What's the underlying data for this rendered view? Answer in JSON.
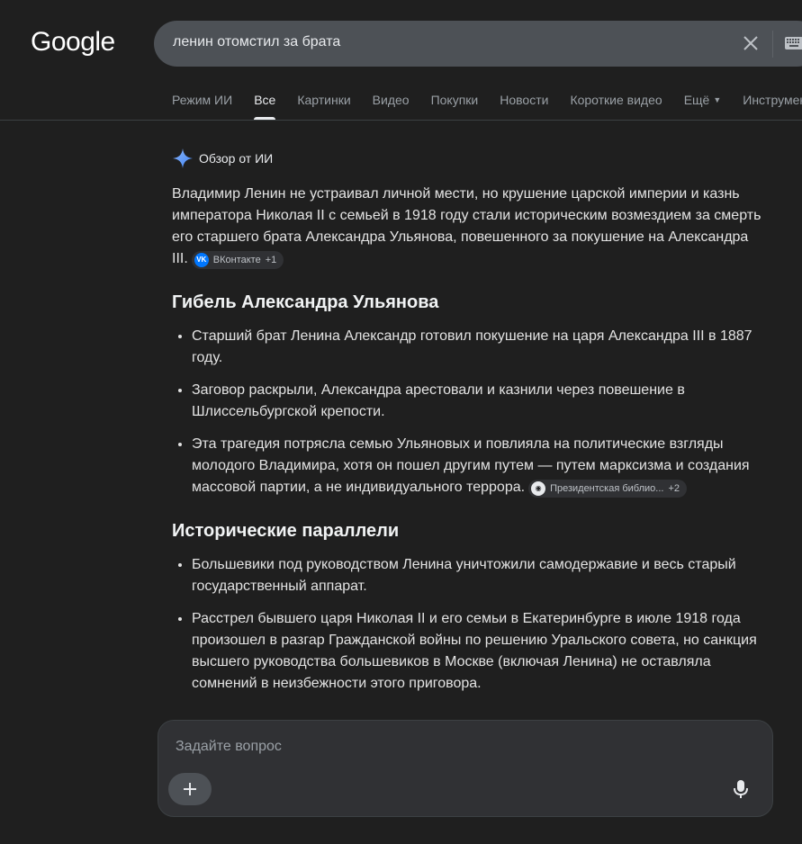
{
  "header": {
    "logo": "Google",
    "search_query": "ленин отомстил за брата"
  },
  "tabs": [
    {
      "label": "Режим ИИ"
    },
    {
      "label": "Все"
    },
    {
      "label": "Картинки"
    },
    {
      "label": "Видео"
    },
    {
      "label": "Покупки"
    },
    {
      "label": "Новости"
    },
    {
      "label": "Короткие видео"
    },
    {
      "label": "Ещё"
    },
    {
      "label": "Инструменты"
    }
  ],
  "ai_overview": {
    "label": "Обзор от ИИ",
    "intro": "Владимир Ленин не устраивал личной мести, но крушение царской империи и казнь императора Николая II с семьей в 1918 году стали историческим возмездием за смерть его старшего брата Александра Ульянова, повешенного за покушение на Александра III.",
    "intro_chip": {
      "source": "ВКонтакте",
      "count": "+1"
    },
    "sections": [
      {
        "heading": "Гибель Александра Ульянова",
        "bullets": [
          "Старший брат Ленина Александр готовил покушение на царя Александра III в 1887 году.",
          "Заговор раскрыли, Александра арестовали и казнили через повешение в Шлиссельбургской крепости.",
          "Эта трагедия потрясла семью Ульяновых и повлияла на политические взгляды молодого Владимира, хотя он пошел другим путем — путем марксизма и создания массовой партии, а не индивидуального террора."
        ],
        "chip": {
          "source": "Президентская библио...",
          "count": "+2"
        }
      },
      {
        "heading": "Исторические параллели",
        "bullets": [
          "Большевики под руководством Ленина уничтожили самодержавие и весь старый государственный аппарат.",
          "Расстрел бывшего царя Николая II и его семьи в Екатеринбурге в июле 1918 года произошел в разгар Гражданской войны по решению Уральского совета, но санкция высшего руководства большевиков в Москве (включая Ленина) не оставляла сомнений в неизбежности этого приговора."
        ]
      }
    ]
  },
  "ask": {
    "placeholder": "Задайте вопрос"
  },
  "colors": {
    "background": "#1f1f1f",
    "search_bg": "#4d5156",
    "chip_vk": "#0077ff",
    "spark_blue": "#8ab4f8"
  }
}
